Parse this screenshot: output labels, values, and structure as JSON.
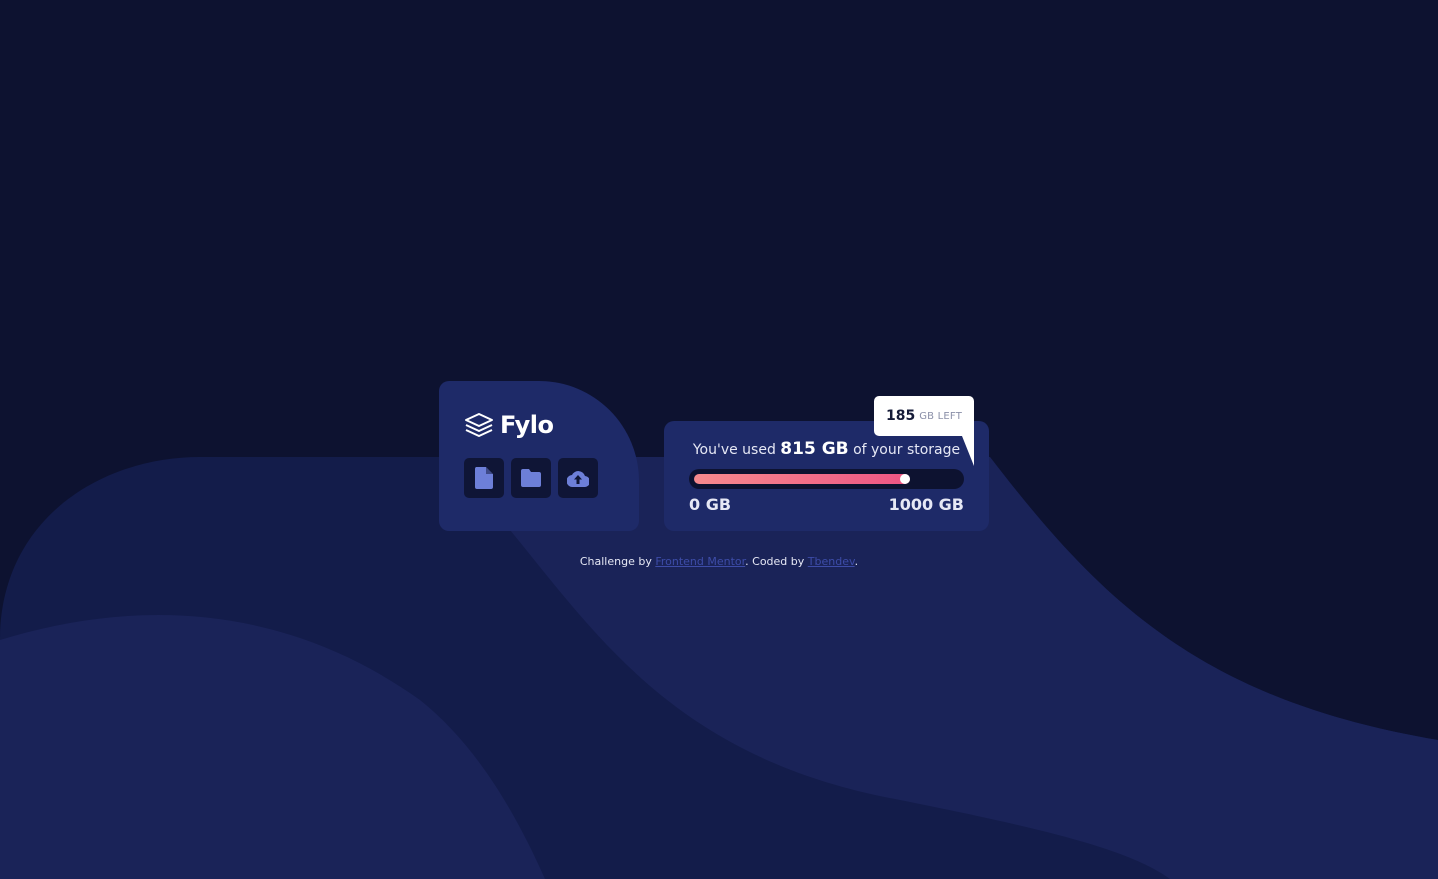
{
  "brand": {
    "name": "Fylo",
    "logo_icon": "layers-icon"
  },
  "toolbar": {
    "icons": [
      "document-icon",
      "folder-icon",
      "upload-icon"
    ]
  },
  "storage": {
    "used_prefix": "You've used",
    "used_amount": "815 GB",
    "used_suffix": "of your storage",
    "used_value": 815,
    "total_value": 1000,
    "min_label": "0 GB",
    "max_label": "1000 GB",
    "remaining_value": "185",
    "remaining_unit": "GB LEFT"
  },
  "footer": {
    "prefix": "Challenge by",
    "link1": "Frontend Mentor",
    "middle": ". Coded by",
    "link2": "Tbendev",
    "suffix": "."
  },
  "colors": {
    "background": "#0d1230",
    "card": "#1e2a68",
    "accent_start": "#f68a8d",
    "accent_end": "#ee5584",
    "icon": "#6d7fd8",
    "link": "#3d4ca8"
  }
}
